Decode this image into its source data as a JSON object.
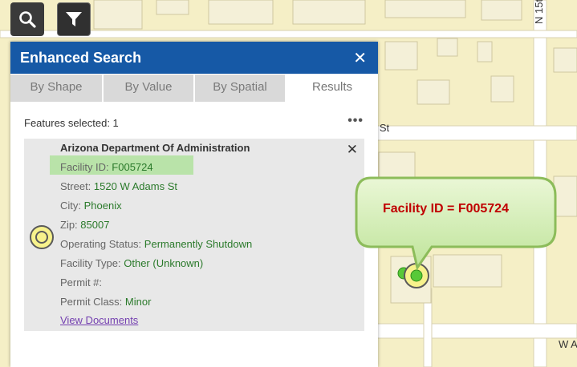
{
  "toolbar": {
    "search_icon": "search-icon",
    "filter_icon": "filter-icon"
  },
  "panel": {
    "title": "Enhanced Search",
    "close_symbol": "✕",
    "tabs": [
      {
        "label": "By Shape",
        "active": false
      },
      {
        "label": "By Value",
        "active": false
      },
      {
        "label": "By Spatial",
        "active": false
      },
      {
        "label": "Results",
        "active": true
      }
    ],
    "summary": "Features selected: 1",
    "more_symbol": "•••"
  },
  "result": {
    "title": "Arizona Department Of Administration",
    "close_symbol": "✕",
    "fields": [
      {
        "label": "Facility ID:",
        "value": "F005724"
      },
      {
        "label": "Street:",
        "value": "1520 W Adams St"
      },
      {
        "label": "City:",
        "value": "Phoenix"
      },
      {
        "label": "Zip:",
        "value": "85007"
      },
      {
        "label": "Operating Status:",
        "value": "Permanently Shutdown"
      },
      {
        "label": "Facility Type:",
        "value": "Other (Unknown)"
      },
      {
        "label": "Permit #:",
        "value": ""
      },
      {
        "label": "Permit Class:",
        "value": "Minor"
      }
    ],
    "link": "View Documents"
  },
  "callout": {
    "text": "Facility ID = F005724"
  },
  "map": {
    "road_labels": [
      "N 15t",
      "e St",
      "W A"
    ]
  },
  "colors": {
    "header": "#1659a6",
    "highlight": "#b9e3a9",
    "value_green": "#2b7a2b",
    "callout_text": "#c00000",
    "map_land": "#f5efc6"
  }
}
